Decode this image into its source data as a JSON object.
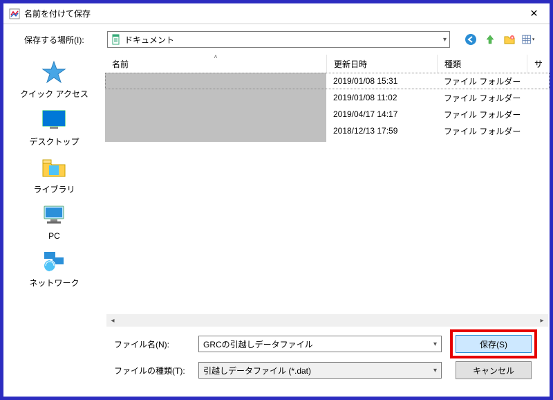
{
  "window": {
    "title": "名前を付けて保存",
    "close": "✕"
  },
  "toolbar": {
    "location_label": "保存する場所(I):",
    "location_value": "ドキュメント",
    "icons": {
      "back": "back-icon",
      "up": "up-icon",
      "newfolder": "newfolder-icon",
      "views": "views-icon"
    }
  },
  "places": [
    {
      "id": "quick",
      "label": "クイック アクセス"
    },
    {
      "id": "desktop",
      "label": "デスクトップ"
    },
    {
      "id": "library",
      "label": "ライブラリ"
    },
    {
      "id": "pc",
      "label": "PC"
    },
    {
      "id": "network",
      "label": "ネットワーク"
    }
  ],
  "columns": {
    "name": "名前",
    "date": "更新日時",
    "type": "種類",
    "size": "サ"
  },
  "rows": [
    {
      "date": "2019/01/08 15:31",
      "type": "ファイル フォルダー",
      "selected": true
    },
    {
      "date": "2019/01/08 11:02",
      "type": "ファイル フォルダー",
      "selected": false
    },
    {
      "date": "2019/04/17 14:17",
      "type": "ファイル フォルダー",
      "selected": false
    },
    {
      "date": "2018/12/13 17:59",
      "type": "ファイル フォルダー",
      "selected": false
    }
  ],
  "form": {
    "filename_label": "ファイル名(N):",
    "filename_value": "GRCの引越しデータファイル",
    "filetype_label": "ファイルの種類(T):",
    "filetype_value": "引越しデータファイル (*.dat)",
    "save": "保存(S)",
    "cancel": "キャンセル"
  }
}
